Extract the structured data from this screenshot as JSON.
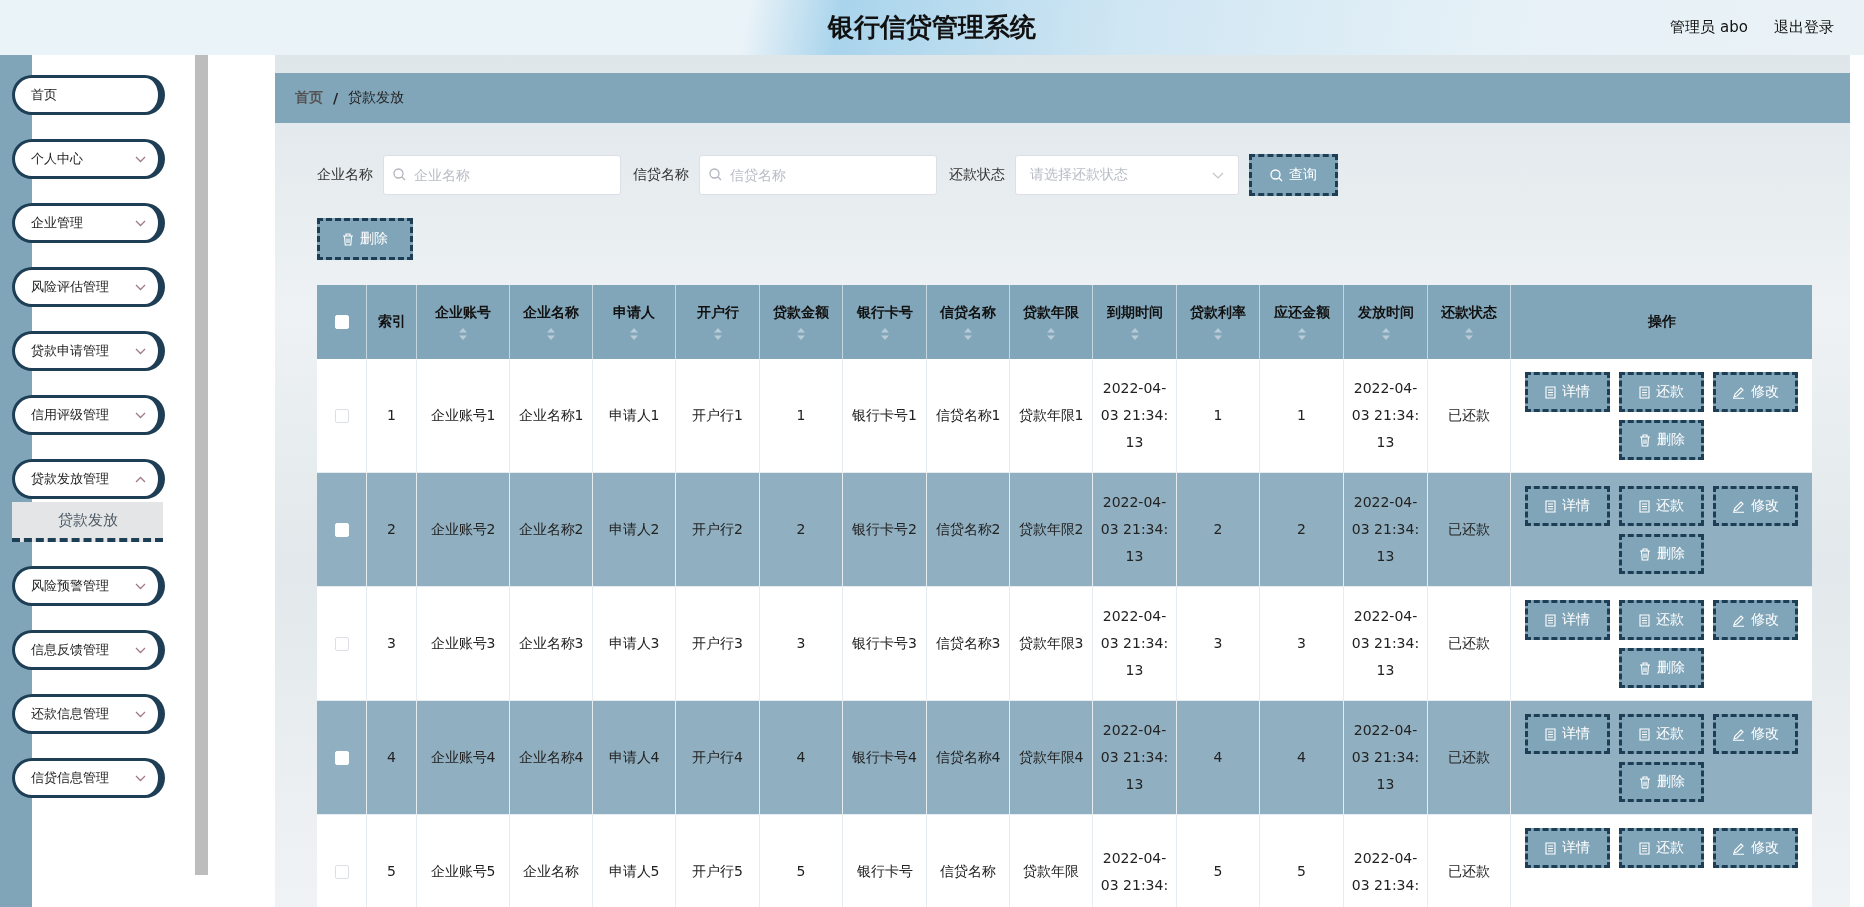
{
  "header": {
    "title": "银行信贷管理系统",
    "user": "管理员 abo",
    "logout": "退出登录"
  },
  "sidebar": {
    "items": [
      {
        "label": "首页",
        "kind": "link"
      },
      {
        "label": "个人中心",
        "kind": "menu",
        "expanded": false
      },
      {
        "label": "企业管理",
        "kind": "menu",
        "expanded": false
      },
      {
        "label": "风险评估管理",
        "kind": "menu",
        "expanded": false
      },
      {
        "label": "贷款申请管理",
        "kind": "menu",
        "expanded": false
      },
      {
        "label": "信用评级管理",
        "kind": "menu",
        "expanded": false
      },
      {
        "label": "贷款发放管理",
        "kind": "menu",
        "expanded": true,
        "children": [
          {
            "label": "贷款发放",
            "selected": true
          }
        ]
      },
      {
        "label": "风险预警管理",
        "kind": "menu",
        "expanded": false
      },
      {
        "label": "信息反馈管理",
        "kind": "menu",
        "expanded": false
      },
      {
        "label": "还款信息管理",
        "kind": "menu",
        "expanded": false
      },
      {
        "label": "信贷信息管理",
        "kind": "menu",
        "expanded": false
      }
    ]
  },
  "breadcrumb": {
    "items": [
      "首页",
      "贷款发放"
    ],
    "separator": "/"
  },
  "filters": [
    {
      "kind": "input",
      "label": "企业名称",
      "placeholder": "企业名称"
    },
    {
      "kind": "input",
      "label": "信贷名称",
      "placeholder": "信贷名称"
    },
    {
      "kind": "select",
      "label": "还款状态",
      "placeholder": "请选择还款状态"
    }
  ],
  "search_button": "查询",
  "delete_button": "删除",
  "table": {
    "select_all_checked": false,
    "columns": [
      {
        "label": "索引",
        "sortable": false
      },
      {
        "label": "企业账号",
        "sortable": true
      },
      {
        "label": "企业名称",
        "sortable": true
      },
      {
        "label": "申请人",
        "sortable": true
      },
      {
        "label": "开户行",
        "sortable": true
      },
      {
        "label": "贷款金额",
        "sortable": true
      },
      {
        "label": "银行卡号",
        "sortable": true
      },
      {
        "label": "信贷名称",
        "sortable": true
      },
      {
        "label": "贷款年限",
        "sortable": true
      },
      {
        "label": "到期时间",
        "sortable": true
      },
      {
        "label": "贷款利率",
        "sortable": true
      },
      {
        "label": "应还金额",
        "sortable": true
      },
      {
        "label": "发放时间",
        "sortable": true
      },
      {
        "label": "还款状态",
        "sortable": true
      },
      {
        "label": "操作",
        "sortable": false
      }
    ],
    "rows": [
      {
        "checked": false,
        "cells": [
          "1",
          "企业账号1",
          "企业名称1",
          "申请人1",
          "开户行1",
          "1",
          "银行卡号1",
          "信贷名称1",
          "贷款年限1",
          "2022-04-03 21:34:13",
          "1",
          "1",
          "2022-04-03 21:34:13",
          "已还款"
        ],
        "actions": [
          "详情",
          "还款",
          "修改",
          "删除"
        ]
      },
      {
        "checked": false,
        "cells": [
          "2",
          "企业账号2",
          "企业名称2",
          "申请人2",
          "开户行2",
          "2",
          "银行卡号2",
          "信贷名称2",
          "贷款年限2",
          "2022-04-03 21:34:13",
          "2",
          "2",
          "2022-04-03 21:34:13",
          "已还款"
        ],
        "actions": [
          "详情",
          "还款",
          "修改",
          "删除"
        ]
      },
      {
        "checked": false,
        "cells": [
          "3",
          "企业账号3",
          "企业名称3",
          "申请人3",
          "开户行3",
          "3",
          "银行卡号3",
          "信贷名称3",
          "贷款年限3",
          "2022-04-03 21:34:13",
          "3",
          "3",
          "2022-04-03 21:34:13",
          "已还款"
        ],
        "actions": [
          "详情",
          "还款",
          "修改",
          "删除"
        ]
      },
      {
        "checked": false,
        "cells": [
          "4",
          "企业账号4",
          "企业名称4",
          "申请人4",
          "开户行4",
          "4",
          "银行卡号4",
          "信贷名称4",
          "贷款年限4",
          "2022-04-03 21:34:13",
          "4",
          "4",
          "2022-04-03 21:34:13",
          "已还款"
        ],
        "actions": [
          "详情",
          "还款",
          "修改",
          "删除"
        ]
      },
      {
        "checked": false,
        "cells": [
          "5",
          "企业账号5",
          "企业名称",
          "申请人5",
          "开户行5",
          "5",
          "银行卡号",
          "信贷名称",
          "贷款年限",
          "2022-04-03 21:34:",
          "5",
          "5",
          "2022-04-03 21:34:",
          "已还款"
        ],
        "actions": [
          "详情",
          "还款",
          "修改"
        ]
      }
    ]
  }
}
